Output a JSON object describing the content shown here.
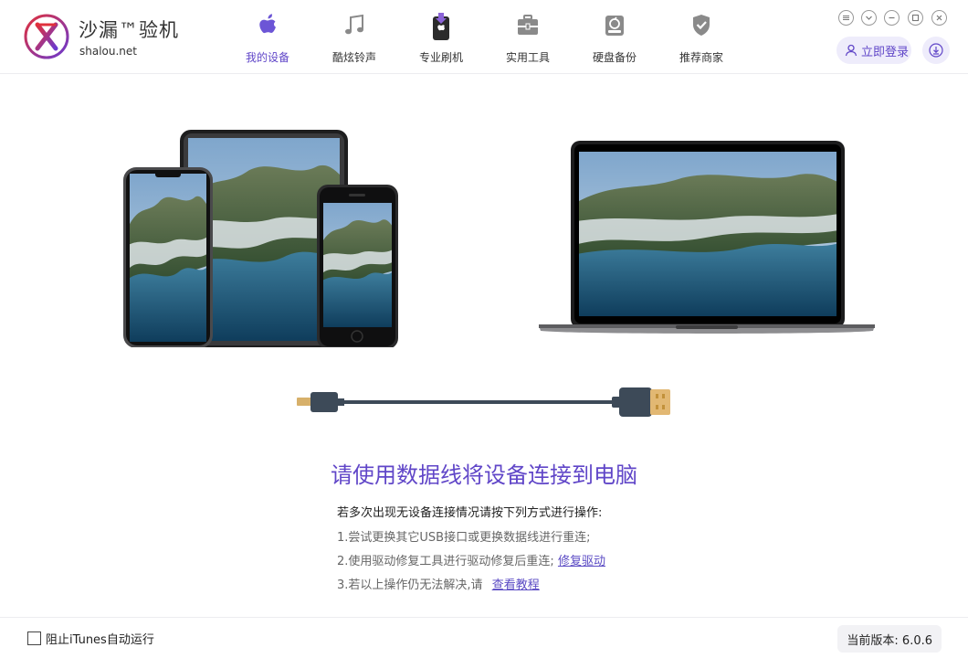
{
  "app": {
    "brand_name": "沙漏™验机",
    "brand_url": "shalou.net"
  },
  "nav": {
    "items": [
      {
        "label": "我的设备",
        "icon": "apple-icon",
        "active": true
      },
      {
        "label": "酷炫铃声",
        "icon": "music-note-icon",
        "active": false
      },
      {
        "label": "专业刷机",
        "icon": "phone-flash-icon",
        "active": false
      },
      {
        "label": "实用工具",
        "icon": "toolbox-icon",
        "active": false
      },
      {
        "label": "硬盘备份",
        "icon": "disk-backup-icon",
        "active": false
      },
      {
        "label": "推荐商家",
        "icon": "shield-check-icon",
        "active": false
      }
    ]
  },
  "window_controls": [
    "menu-icon",
    "dropdown-icon",
    "minimize-icon",
    "maximize-icon",
    "close-icon"
  ],
  "header": {
    "login_label": "立即登录"
  },
  "main": {
    "headline": "请使用数据线将设备连接到电脑",
    "tips_title": "若多次出现无设备连接情况请按下列方式进行操作:",
    "tip1": "1.尝试更换其它USB接口或更换数据线进行重连;",
    "tip2_text": "2.使用驱动修复工具进行驱动修复后重连;",
    "tip2_link": "修复驱动",
    "tip3_text": "3.若以上操作仍无法解决,请",
    "tip3_link": "查看教程"
  },
  "footer": {
    "itunes_label": "阻止iTunes自动运行",
    "itunes_checked": false,
    "version_label": "当前版本: 6.0.6"
  },
  "colors": {
    "accent": "#6046c8",
    "accent_bg": "#eeecfb"
  }
}
